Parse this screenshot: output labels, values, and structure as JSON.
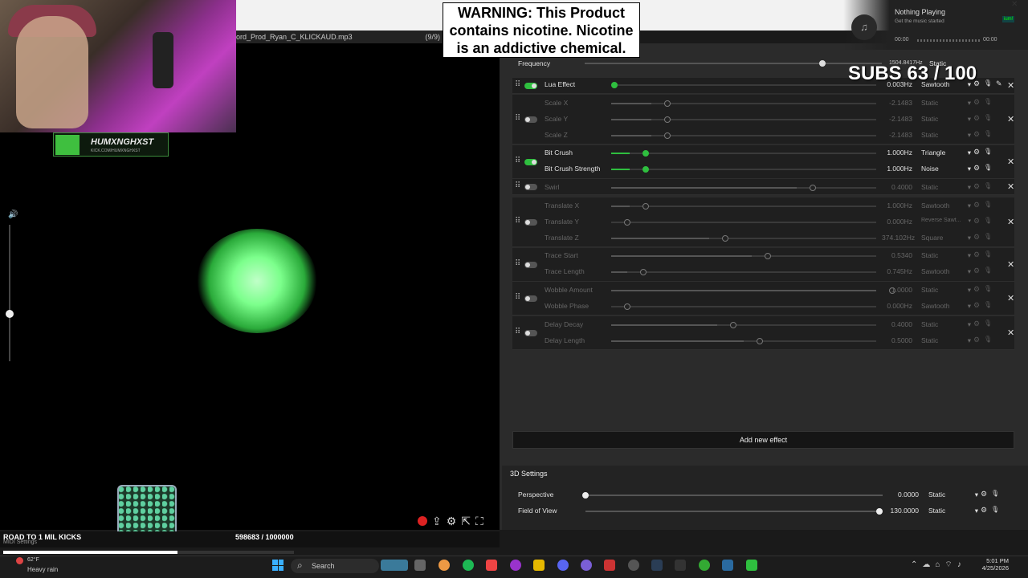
{
  "window": {
    "title": "ord_Prod_Ryan_C_KLICKAUD.mp3",
    "track_count": "(9/9)"
  },
  "warning": {
    "text": "WARNING: This Product contains nicotine. Nicotine is an addictive chemical."
  },
  "streamer": {
    "handle": "HUMXNGHXST",
    "handle_sub": "KICK.COM/HUMXNGHXST"
  },
  "goal": {
    "label": "ROAD TO 1 MIL KICKS",
    "count_text": "598683 / 1000000",
    "progress": 0.598683,
    "midi_label": "MIDI Settings"
  },
  "frequency": {
    "label": "Frequency",
    "value": "1504.8417Hz",
    "mode": "Static",
    "level": 0.8
  },
  "subs": {
    "text": "SUBS 63 / 100"
  },
  "music": {
    "title": "Nothing Playing",
    "subtitle": "Get the music started",
    "time_start": "00:00",
    "time_end": "00:00",
    "badge": "ium!"
  },
  "effects": [
    {
      "enabled": true,
      "rows": [
        {
          "label": "Lua Effect",
          "value": "0.003Hz",
          "mode": "Sawtooth",
          "level": 0.0,
          "active": true,
          "edit": true
        }
      ]
    },
    {
      "enabled": false,
      "rows": [
        {
          "label": "Scale X",
          "value": "-2.1483",
          "mode": "Static",
          "level": 0.15,
          "active": false
        },
        {
          "label": "Scale Y",
          "value": "-2.1483",
          "mode": "Static",
          "level": 0.15,
          "active": false
        },
        {
          "label": "Scale Z",
          "value": "-2.1483",
          "mode": "Static",
          "level": 0.15,
          "active": false
        }
      ]
    },
    {
      "enabled": true,
      "rows": [
        {
          "label": "Bit Crush",
          "value": "1.000Hz",
          "mode": "Triangle",
          "level": 0.07,
          "active": true
        },
        {
          "label": "Bit Crush Strength",
          "value": "1.000Hz",
          "mode": "Noise",
          "level": 0.07,
          "active": true
        }
      ]
    },
    {
      "enabled": false,
      "rows": [
        {
          "label": "Swirl",
          "value": "0.4000",
          "mode": "Static",
          "level": 0.7,
          "active": false
        }
      ]
    },
    {
      "enabled": false,
      "rows": [
        {
          "label": "Translate X",
          "value": "1.000Hz",
          "mode": "Sawtooth",
          "level": 0.07,
          "active": false
        },
        {
          "label": "Translate Y",
          "value": "0.000Hz",
          "mode": "Reverse Sawt...",
          "level": 0.0,
          "active": false
        },
        {
          "label": "Translate Z",
          "value": "374.102Hz",
          "mode": "Square",
          "level": 0.37,
          "active": false
        }
      ]
    },
    {
      "enabled": false,
      "rows": [
        {
          "label": "Trace Start",
          "value": "0.5340",
          "mode": "Static",
          "level": 0.53,
          "active": false
        },
        {
          "label": "Trace Length",
          "value": "0.745Hz",
          "mode": "Sawtooth",
          "level": 0.06,
          "active": false
        }
      ]
    },
    {
      "enabled": false,
      "rows": [
        {
          "label": "Wobble Amount",
          "value": "1.0000",
          "mode": "Static",
          "level": 1.0,
          "active": false
        },
        {
          "label": "Wobble Phase",
          "value": "0.000Hz",
          "mode": "Sawtooth",
          "level": 0.0,
          "active": false
        }
      ]
    },
    {
      "enabled": false,
      "rows": [
        {
          "label": "Delay Decay",
          "value": "0.4000",
          "mode": "Static",
          "level": 0.4,
          "active": false
        },
        {
          "label": "Delay Length",
          "value": "0.5000",
          "mode": "Static",
          "level": 0.5,
          "active": false
        }
      ]
    }
  ],
  "add_effect_label": "Add new effect",
  "settings_3d": {
    "header": "3D Settings",
    "rows": [
      {
        "label": "Perspective",
        "value": "0.0000",
        "mode": "Static",
        "level": 0.0
      },
      {
        "label": "Field of View",
        "value": "130.0000",
        "mode": "Static",
        "level": 1.0
      }
    ]
  },
  "taskbar": {
    "weather_temp": "62°F",
    "weather_desc": "Heavy rain",
    "search_placeholder": "Search",
    "time": "5:01 PM",
    "date": "4/25/2026"
  }
}
